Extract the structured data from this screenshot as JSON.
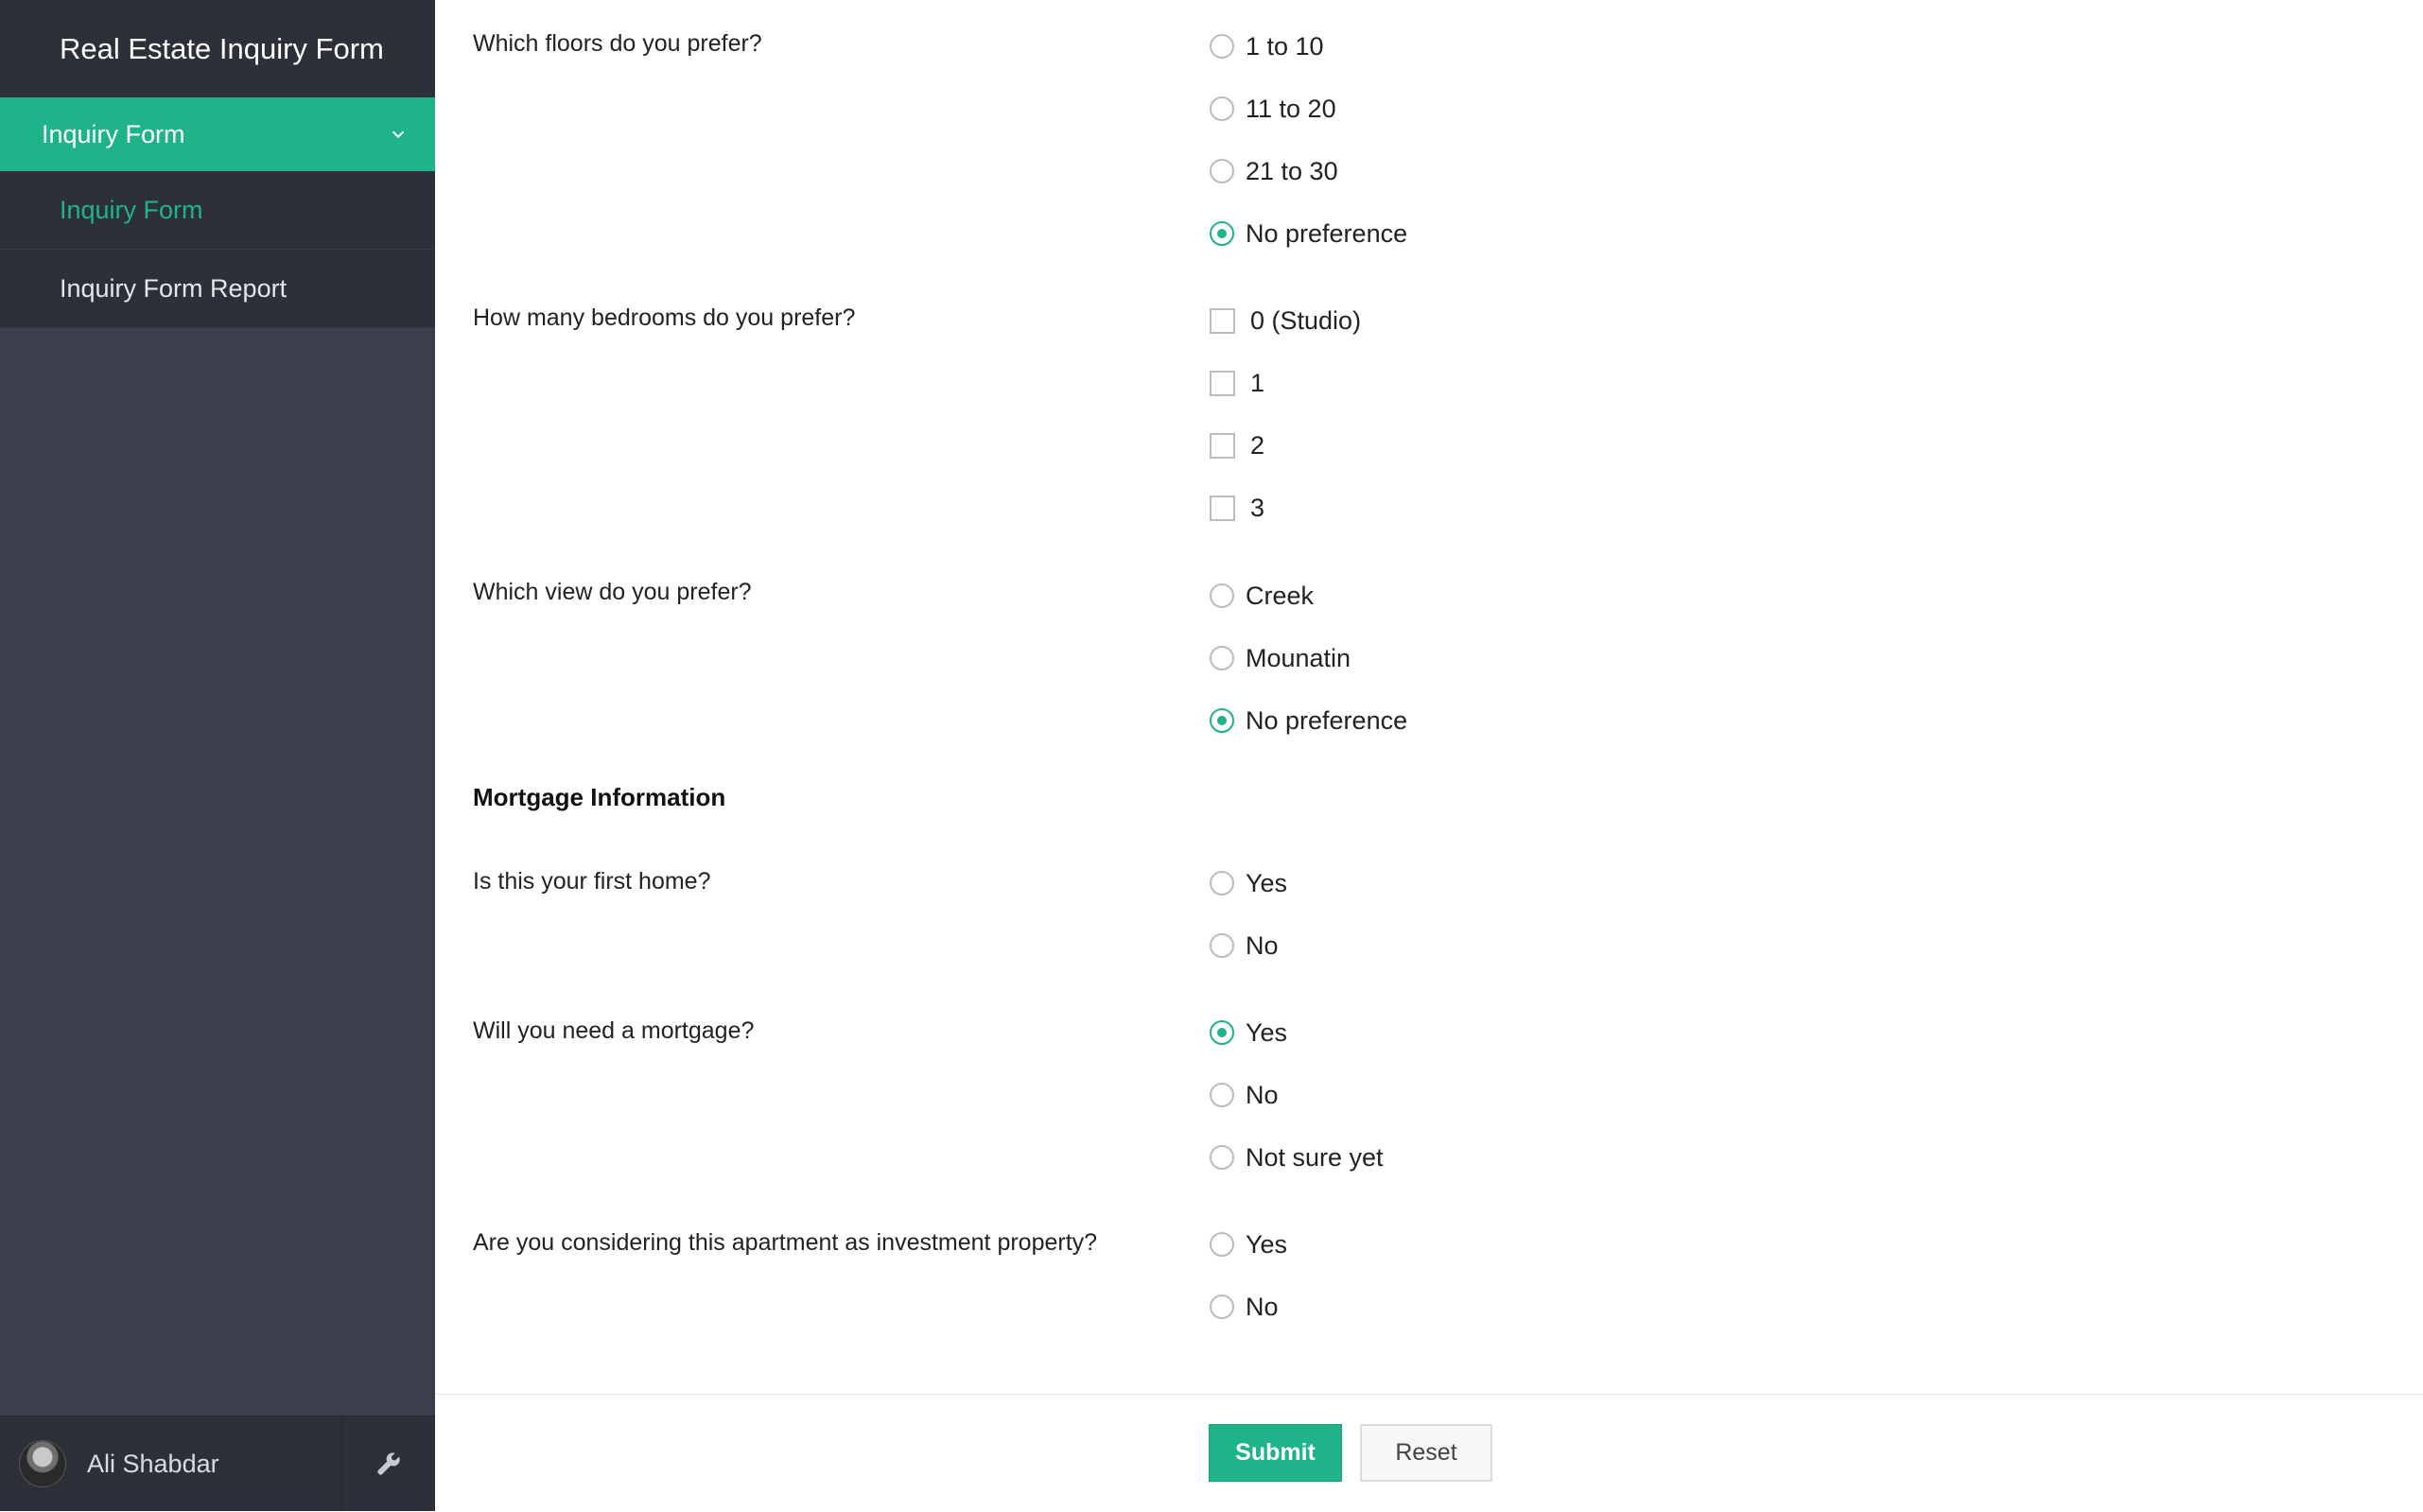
{
  "app": {
    "title": "Real Estate Inquiry Form",
    "accent": "#1fb38a"
  },
  "sidebar": {
    "group_label": "Inquiry Form",
    "items": [
      {
        "label": "Inquiry Form",
        "active": true
      },
      {
        "label": "Inquiry Form Report",
        "active": false
      }
    ],
    "user_name": "Ali Shabdar",
    "tools_icon": "wrench-icon"
  },
  "form": {
    "floors": {
      "question": "Which floors do you prefer?",
      "options": [
        "1 to 10",
        "11 to 20",
        "21 to 30",
        "No preference"
      ],
      "selected": "No preference"
    },
    "bedrooms": {
      "question": "How many bedrooms do you prefer?",
      "options": [
        "0 (Studio)",
        "1",
        "2",
        "3"
      ],
      "checked": []
    },
    "view": {
      "question": "Which view do you prefer?",
      "options": [
        "Creek",
        "Mounatin",
        "No preference"
      ],
      "selected": "No preference"
    },
    "mortgage_section": "Mortgage Information",
    "first_home": {
      "question": "Is this your first home?",
      "options": [
        "Yes",
        "No"
      ],
      "selected": null
    },
    "need_mortgage": {
      "question": "Will you need a mortgage?",
      "options": [
        "Yes",
        "No",
        "Not sure yet"
      ],
      "selected": "Yes"
    },
    "investment": {
      "question": "Are you considering this apartment as investment property?",
      "options": [
        "Yes",
        "No"
      ],
      "selected": null
    }
  },
  "actions": {
    "submit_label": "Submit",
    "reset_label": "Reset"
  }
}
